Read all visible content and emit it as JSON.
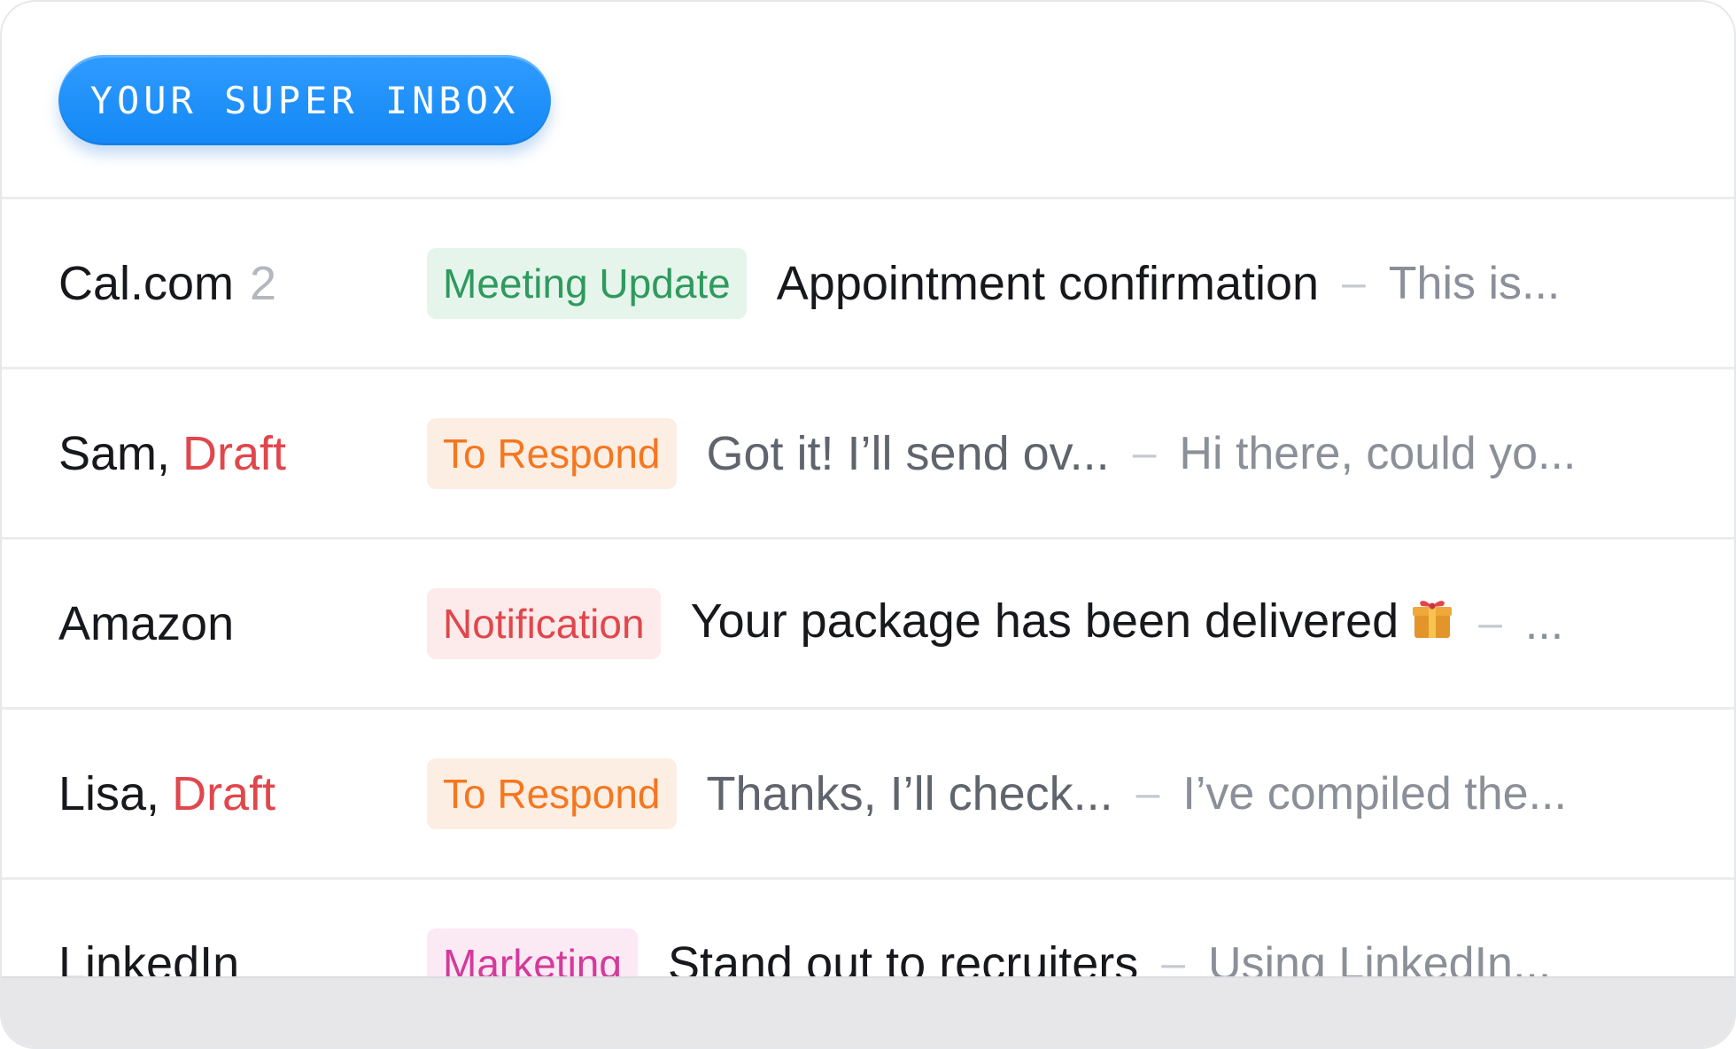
{
  "header": {
    "badge_label": "YOUR SUPER INBOX"
  },
  "emails": [
    {
      "sender": "Cal.com",
      "count": "2",
      "draft": "",
      "tag": "Meeting Update",
      "tag_colors": {
        "bg": "#e5f5ec",
        "fg": "#2f9a5d"
      },
      "subject": "Appointment confirmation",
      "separator": "–",
      "preview": "This is..."
    },
    {
      "sender": "Sam,",
      "count": "",
      "draft": "Draft",
      "tag": "To Respond",
      "tag_colors": {
        "bg": "#fdeee4",
        "fg": "#f4771f"
      },
      "subject": "Got it! I’ll send ov...",
      "separator": "–",
      "preview": "Hi there, could yo..."
    },
    {
      "sender": "Amazon",
      "count": "",
      "draft": "",
      "tag": "Notification",
      "tag_colors": {
        "bg": "#fdeaea",
        "fg": "#e0474c"
      },
      "subject": "Your package has been delivered",
      "subject_icon": "gift-icon",
      "separator": "–",
      "preview": "..."
    },
    {
      "sender": "Lisa,",
      "count": "",
      "draft": "Draft",
      "tag": "To Respond",
      "tag_colors": {
        "bg": "#fdeee4",
        "fg": "#f4771f"
      },
      "subject": "Thanks, I’ll check...",
      "separator": "–",
      "preview": "I’ve compiled the..."
    },
    {
      "sender": "LinkedIn",
      "count": "",
      "draft": "",
      "tag": "Marketing",
      "tag_colors": {
        "bg": "#fbe9f4",
        "fg": "#d23b9a"
      },
      "subject": "Stand out to recruiters",
      "separator": "–",
      "preview": "Using LinkedIn..."
    }
  ]
}
